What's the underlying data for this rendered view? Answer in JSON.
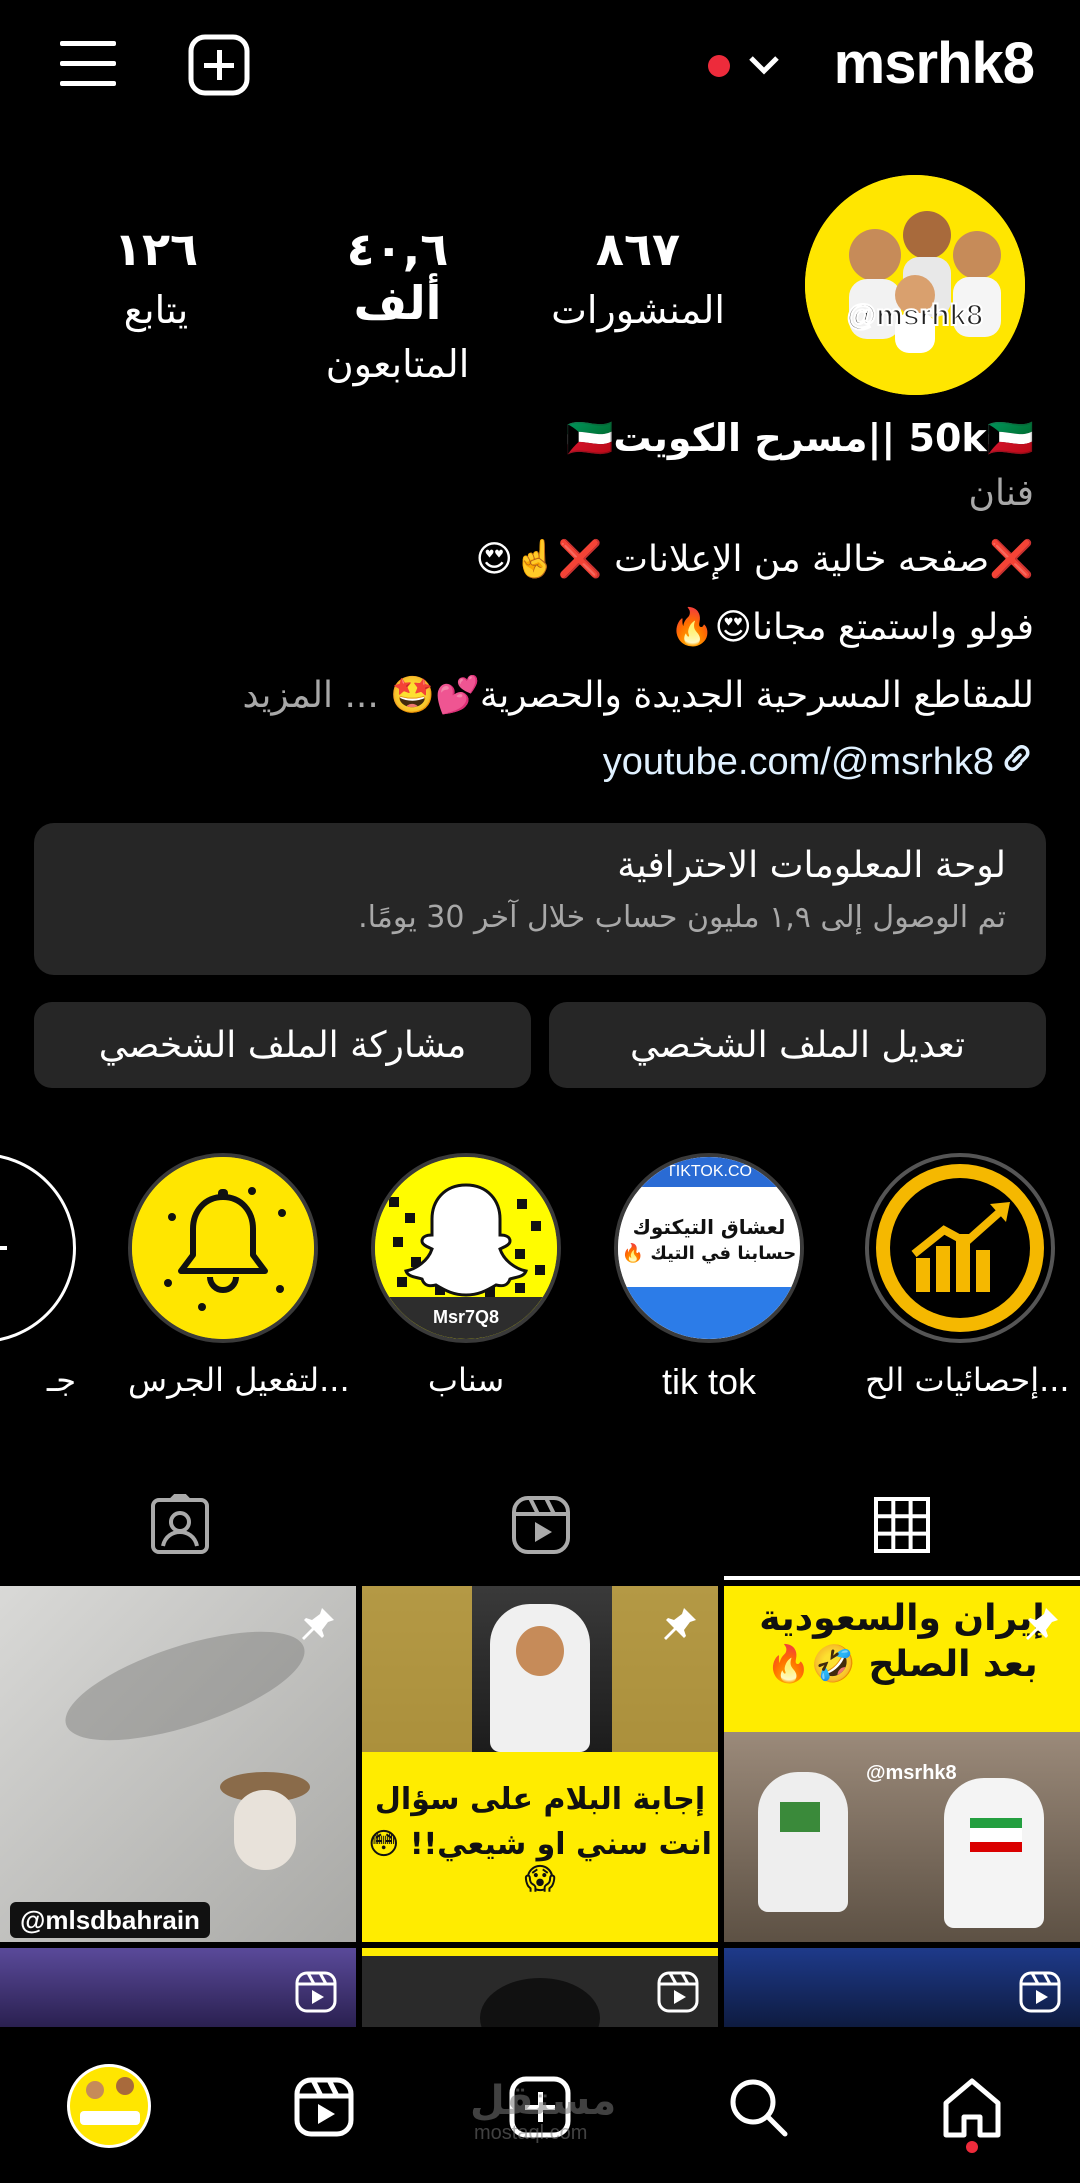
{
  "header": {
    "username": "msrhk8",
    "notification_color": "#ed2b3b"
  },
  "stats": {
    "posts": {
      "value": "٨٦٧",
      "label": "المنشورات"
    },
    "followers": {
      "value": "٤٠,٦ ألف",
      "label": "المتابعون"
    },
    "following": {
      "value": "١٢٦",
      "label": "يتابع"
    }
  },
  "avatar": {
    "handle_text": "@msrhk8"
  },
  "bio": {
    "name": "50k🇰🇼 ||مسرح الكويت🇰🇼",
    "category": "فنان",
    "line1": "❌صفحه خالية من الإعلانات ❌☝️😍",
    "line2": "فولو واستمتع مجانا😍🔥",
    "line3": "للمقاطع المسرحية الجديدة والحصرية💕🤩",
    "more": "... المزيد",
    "link": "youtube.com/@msrhk8"
  },
  "dashboard": {
    "title": "لوحة المعلومات الاحترافية",
    "subtitle": "تم الوصول إلى ١,٩ مليون حساب خلال آخر 30 يومًا."
  },
  "buttons": {
    "edit_profile": "تعديل الملف الشخصي",
    "share_profile": "مشاركة الملف الشخصي"
  },
  "highlights": [
    {
      "label": "إحصائيات الح...",
      "icon": "chart-icon"
    },
    {
      "label": "tik tok",
      "icon": "tiktok-thumbnail",
      "thumb_text_1": "لعشاق التيكتوك",
      "thumb_text_2": "حسابنا في التيك 🔥",
      "thumb_url": "TIKTOK.CO"
    },
    {
      "label": "سناب",
      "icon": "snapchat-icon",
      "thumb_text": "Msr7Q8"
    },
    {
      "label": "لتفعيل الجرس...",
      "icon": "bell-icon"
    },
    {
      "label": "جـ",
      "icon": "add-icon"
    }
  ],
  "tabs": [
    "grid",
    "reels",
    "tagged"
  ],
  "grid": [
    {
      "caption": "إيران والسعودية",
      "caption2": "بعد الصلح 🤣🔥",
      "type": "pinned",
      "watermark": "@msrhk8"
    },
    {
      "caption": "إجابة البلام على سؤال",
      "caption2": "انت سني او شيعي!! 😳😱",
      "type": "pinned"
    },
    {
      "caption": "@mlsdbahrain",
      "type": "pinned"
    },
    {
      "type": "reel"
    },
    {
      "type": "reel"
    },
    {
      "type": "reel"
    }
  ],
  "watermark": {
    "main": "مستقل",
    "sub": "mostaql.com"
  },
  "colors": {
    "accent_yellow": "#ffe600",
    "surface": "#262626",
    "muted": "#a8a8a8",
    "link": "#e0f1ff"
  }
}
